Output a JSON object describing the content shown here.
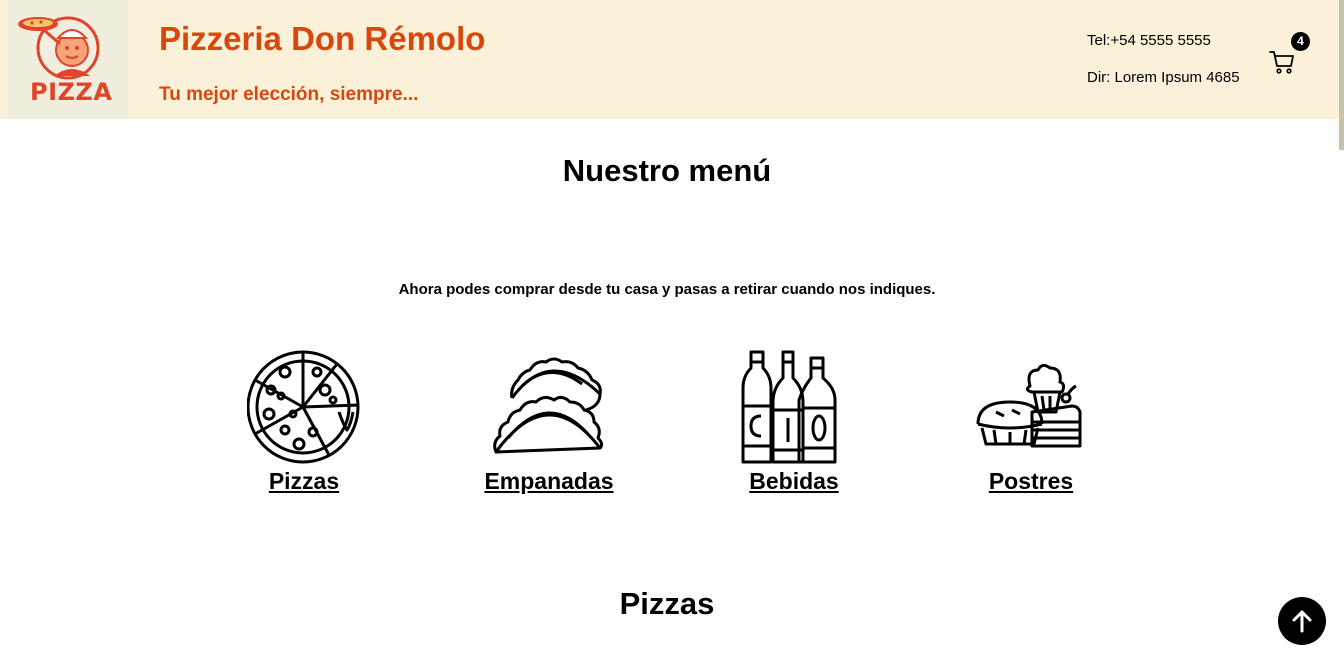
{
  "header": {
    "logo_text": "PIZZA",
    "logo_icon": "pizza-chef-logo",
    "title": "Pizzeria Don Rémolo",
    "subtitle": "Tu mejor elección, siempre...",
    "phone": "Tel:+54 5555 5555",
    "address": "Dir: Lorem Ipsum 4685",
    "cart_icon": "cart-icon",
    "cart_count": "4"
  },
  "menu": {
    "title": "Nuestro menú",
    "intro": "Ahora podes comprar desde tu casa y pasas a retirar cuando nos indiques.",
    "categories": [
      {
        "label": "Pizzas",
        "icon": "pizza-icon"
      },
      {
        "label": "Empanadas",
        "icon": "empanada-icon"
      },
      {
        "label": "Bebidas",
        "icon": "bottles-icon"
      },
      {
        "label": "Postres",
        "icon": "dessert-icon"
      }
    ]
  },
  "section": {
    "title": "Pizzas"
  },
  "colors": {
    "header_bg": "#fbf0d8",
    "brand": "#d8480e",
    "text": "#000000"
  },
  "back_to_top_icon": "arrow-up-icon"
}
